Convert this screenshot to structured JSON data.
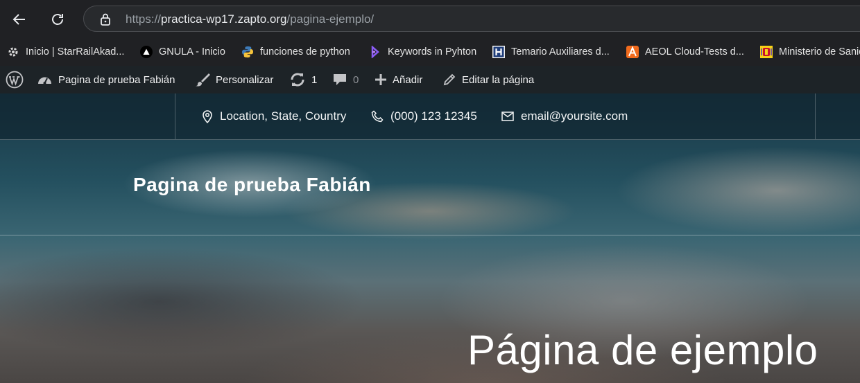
{
  "browser": {
    "url_scheme": "https://",
    "url_host": "practica-wp17.zapto.org",
    "url_path": "/pagina-ejemplo/"
  },
  "bookmarks": [
    {
      "label": "Inicio | StarRailAkad...",
      "icon": "gear-icon"
    },
    {
      "label": "GNULA - Inicio",
      "icon": "triangle-icon"
    },
    {
      "label": "funciones de python",
      "icon": "python-icon"
    },
    {
      "label": "Keywords in Pyhton",
      "icon": "purple-logo-icon"
    },
    {
      "label": "Temario Auxiliares d...",
      "icon": "h-logo-icon"
    },
    {
      "label": "AEOL Cloud-Tests d...",
      "icon": "a-logo-icon"
    },
    {
      "label": "Ministerio de Sanida",
      "icon": "coat-of-arms-icon"
    }
  ],
  "admin_bar": {
    "site_name": "Pagina de prueba Fabián",
    "customize": "Personalizar",
    "updates_count": "1",
    "comments_count": "0",
    "add_new": "Añadir",
    "edit_page": "Editar la página"
  },
  "site": {
    "location": "Location, State, Country",
    "phone": "(000) 123 12345",
    "email": "email@yoursite.com",
    "site_title": "Pagina de prueba Fabián",
    "page_title": "Página de ejemplo"
  },
  "colors": {
    "browser_bg": "#202124",
    "admin_bar_bg": "#1d2327",
    "python_blue": "#3d7ab8",
    "python_yellow": "#f5c33b"
  }
}
